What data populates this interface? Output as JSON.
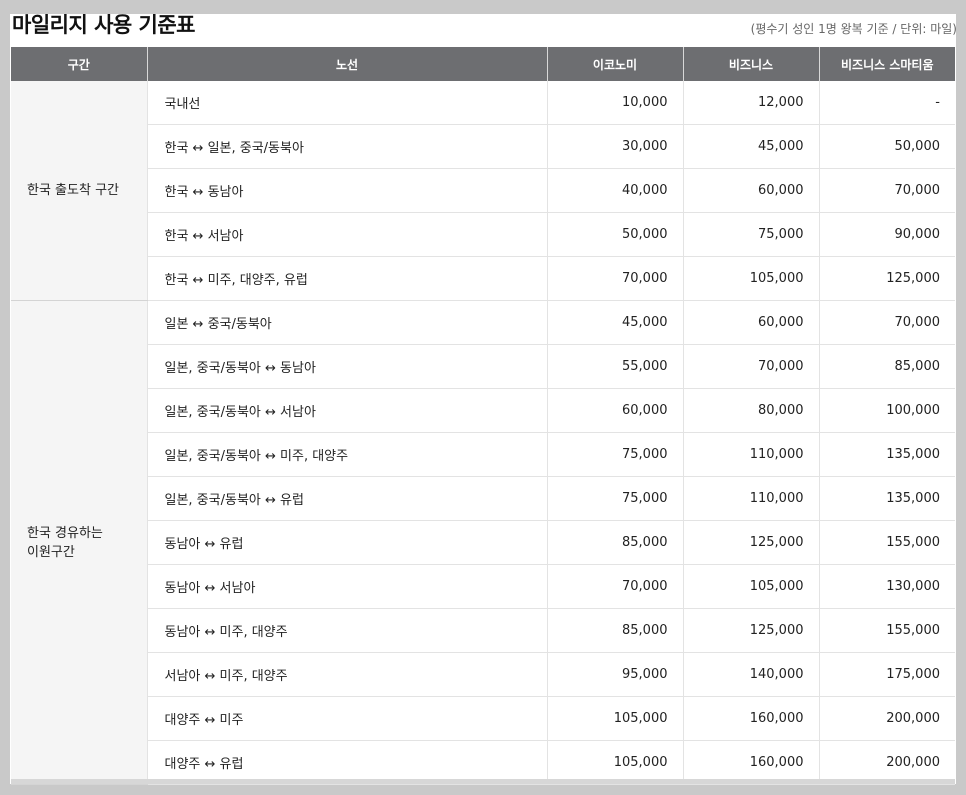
{
  "title": "마일리지 사용 기준표",
  "note": "(평수기 성인 1명 왕복 기준 / 단위: 마일)",
  "headers": [
    "구간",
    "노선",
    "이코노미",
    "비즈니스",
    "비즈니스 스마티움"
  ],
  "sections": [
    {
      "name_lines": [
        "한국 출도착 구간"
      ],
      "rows": [
        {
          "route": "국내선",
          "economy": "10,000",
          "business": "12,000",
          "smartium": "-"
        },
        {
          "route": "한국 ↔ 일본, 중국/동북아",
          "economy": "30,000",
          "business": "45,000",
          "smartium": "50,000"
        },
        {
          "route": "한국 ↔ 동남아",
          "economy": "40,000",
          "business": "60,000",
          "smartium": "70,000"
        },
        {
          "route": "한국 ↔ 서남아",
          "economy": "50,000",
          "business": "75,000",
          "smartium": "90,000"
        },
        {
          "route": "한국 ↔ 미주, 대양주, 유럽",
          "economy": "70,000",
          "business": "105,000",
          "smartium": "125,000"
        }
      ]
    },
    {
      "name_lines": [
        "한국 경유하는",
        "이원구간"
      ],
      "rows": [
        {
          "route": "일본 ↔ 중국/동북아",
          "economy": "45,000",
          "business": "60,000",
          "smartium": "70,000"
        },
        {
          "route": "일본, 중국/동북아 ↔ 동남아",
          "economy": "55,000",
          "business": "70,000",
          "smartium": "85,000"
        },
        {
          "route": "일본, 중국/동북아 ↔ 서남아",
          "economy": "60,000",
          "business": "80,000",
          "smartium": "100,000"
        },
        {
          "route": "일본, 중국/동북아 ↔ 미주, 대양주",
          "economy": "75,000",
          "business": "110,000",
          "smartium": "135,000"
        },
        {
          "route": "일본, 중국/동북아 ↔ 유럽",
          "economy": "75,000",
          "business": "110,000",
          "smartium": "135,000"
        },
        {
          "route": "동남아 ↔ 유럽",
          "economy": "85,000",
          "business": "125,000",
          "smartium": "155,000"
        },
        {
          "route": "동남아 ↔ 서남아",
          "economy": "70,000",
          "business": "105,000",
          "smartium": "130,000"
        },
        {
          "route": "동남아 ↔ 미주, 대양주",
          "economy": "85,000",
          "business": "125,000",
          "smartium": "155,000"
        },
        {
          "route": "서남아 ↔ 미주, 대양주",
          "economy": "95,000",
          "business": "140,000",
          "smartium": "175,000"
        },
        {
          "route": "대양주 ↔ 미주",
          "economy": "105,000",
          "business": "160,000",
          "smartium": "200,000"
        },
        {
          "route": "대양주 ↔ 유럽",
          "economy": "105,000",
          "business": "160,000",
          "smartium": "200,000"
        }
      ]
    }
  ]
}
